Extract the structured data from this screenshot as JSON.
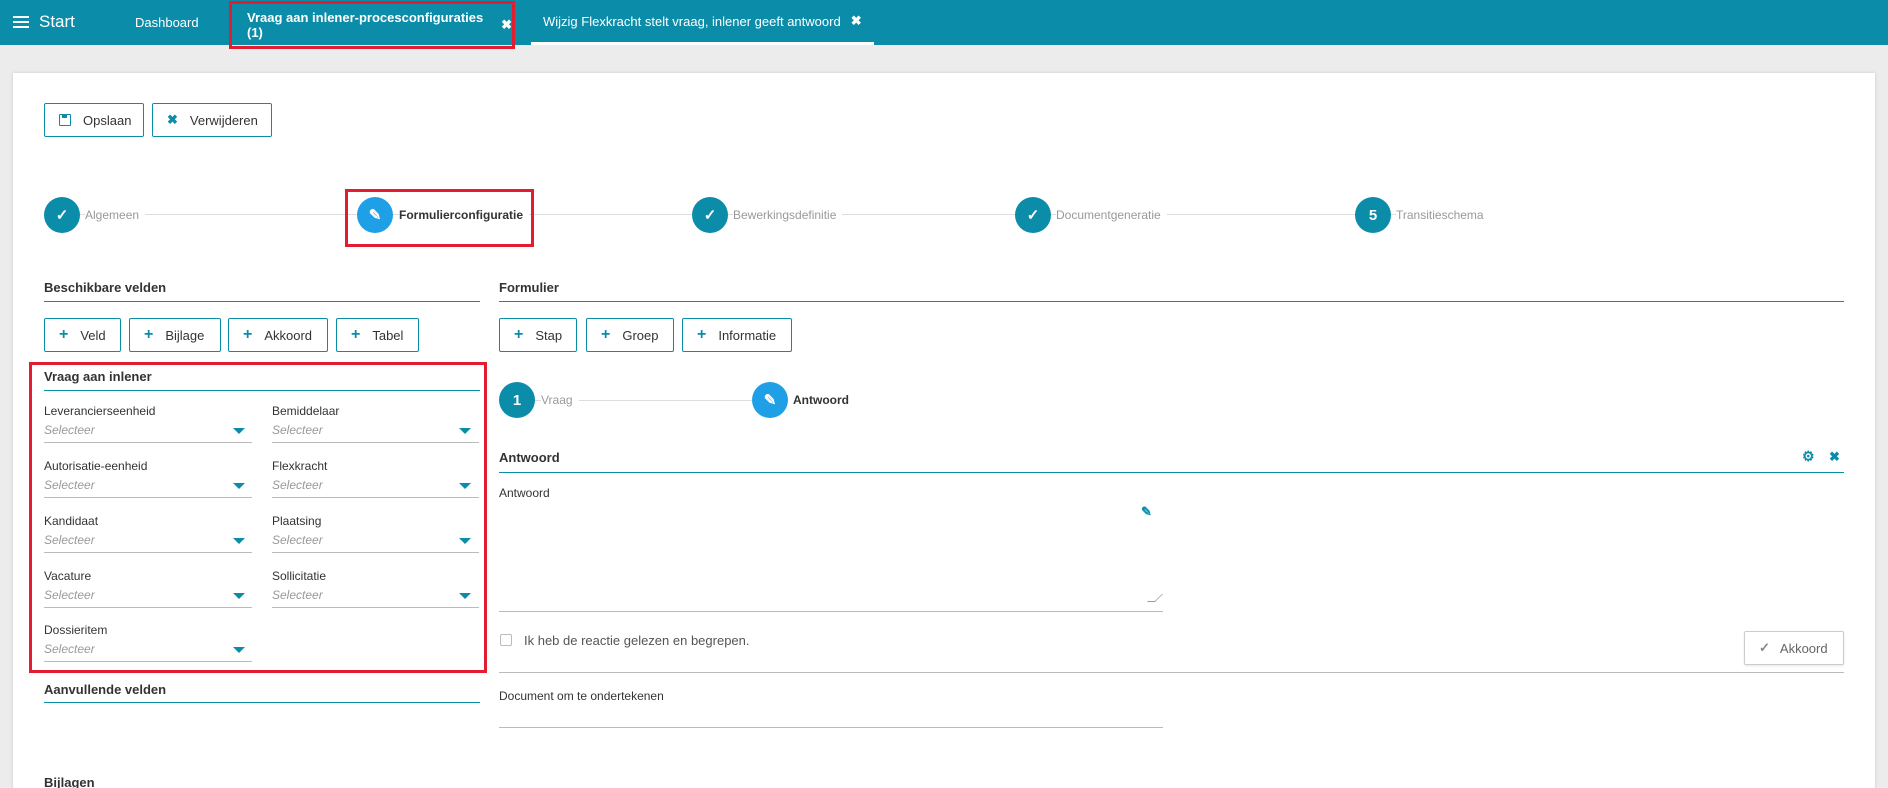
{
  "header": {
    "start_label": "Start",
    "tabs": [
      {
        "label": "Dashboard"
      },
      {
        "label": "Vraag aan inlener-procesconfiguraties (1)",
        "close": "✖"
      },
      {
        "label": "Wijzig Flexkracht stelt vraag, inlener geeft antwoord",
        "close": "✖"
      }
    ],
    "accent_color": "#0b8ca8"
  },
  "toolbar": {
    "save_label": "Opslaan",
    "delete_label": "Verwijderen",
    "delete_icon": "✖"
  },
  "stepper": {
    "steps": [
      {
        "label": "Algemeen",
        "state": "done",
        "glyph": "✓"
      },
      {
        "label": "Formulierconfiguratie",
        "state": "active",
        "glyph": "✎"
      },
      {
        "label": "Bewerkingsdefinitie",
        "state": "done",
        "glyph": "✓"
      },
      {
        "label": "Documentgeneratie",
        "state": "done",
        "glyph": "✓"
      },
      {
        "label": "Transitieschema",
        "state": "pending",
        "glyph": "5"
      }
    ]
  },
  "left": {
    "title": "Beschikbare velden",
    "add_buttons": [
      {
        "label": "Veld"
      },
      {
        "label": "Bijlage"
      },
      {
        "label": "Akkoord"
      },
      {
        "label": "Tabel"
      }
    ],
    "group_title": "Vraag aan inlener",
    "fields": [
      {
        "label": "Leverancierseenheid",
        "value": "Selecteer"
      },
      {
        "label": "Bemiddelaar",
        "value": "Selecteer"
      },
      {
        "label": "Autorisatie-eenheid",
        "value": "Selecteer"
      },
      {
        "label": "Flexkracht",
        "value": "Selecteer"
      },
      {
        "label": "Kandidaat",
        "value": "Selecteer"
      },
      {
        "label": "Plaatsing",
        "value": "Selecteer"
      },
      {
        "label": "Vacature",
        "value": "Selecteer"
      },
      {
        "label": "Sollicitatie",
        "value": "Selecteer"
      },
      {
        "label": "Dossieritem",
        "value": "Selecteer"
      }
    ],
    "extra_title": "Aanvullende velden",
    "attachments_title": "Bijlagen"
  },
  "right": {
    "title": "Formulier",
    "add_buttons": [
      {
        "label": "Stap"
      },
      {
        "label": "Groep"
      },
      {
        "label": "Informatie"
      }
    ],
    "steps": [
      {
        "label": "Vraag",
        "glyph": "1"
      },
      {
        "label": "Antwoord",
        "glyph": "✎"
      }
    ],
    "group_title": "Antwoord",
    "textarea_label": "Antwoord",
    "checkbox_label": "Ik heb de reactie gelezen en begrepen.",
    "akkoord_label": "Akkoord",
    "document_label": "Document om te ondertekenen"
  }
}
